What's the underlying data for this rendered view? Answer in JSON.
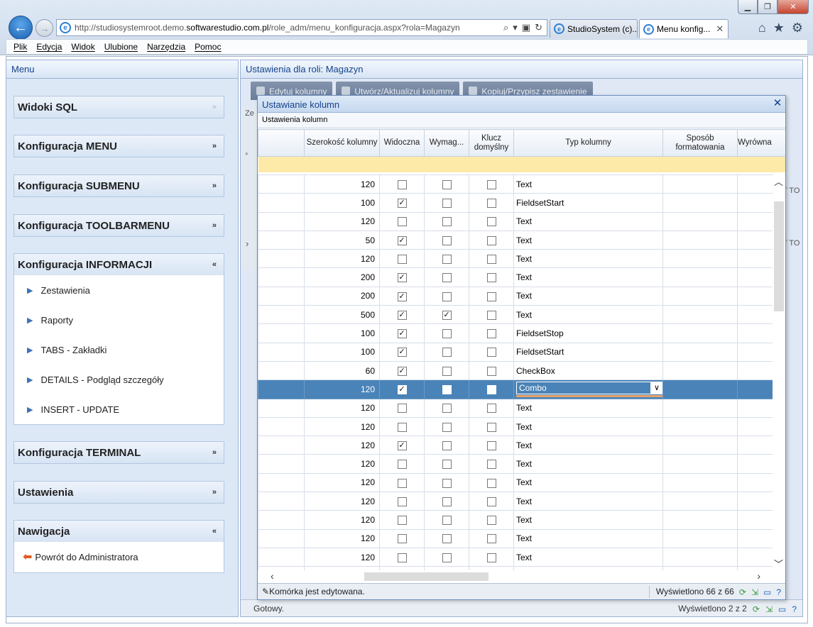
{
  "browser": {
    "url_prefix": "http://studiosystemroot.demo.",
    "url_domain": "softwarestudio.com.pl",
    "url_suffix": "/role_adm/menu_konfiguracja.aspx?rola=Magazyn",
    "tabs": [
      {
        "label": "StudioSystem (c)..."
      },
      {
        "label": "Menu konfig..."
      }
    ],
    "menu": [
      "Plik",
      "Edycja",
      "Widok",
      "Ulubione",
      "Narzędzia",
      "Pomoc"
    ]
  },
  "left_panel": {
    "title": "Menu",
    "sections": [
      {
        "title": "Widoki SQL"
      },
      {
        "title": "Konfiguracja MENU"
      },
      {
        "title": "Konfiguracja SUBMENU"
      },
      {
        "title": "Konfiguracja TOOLBARMENU"
      },
      {
        "title": "Konfiguracja INFORMACJI",
        "items": [
          "Zestawienia",
          "Raporty",
          "TABS - Zakładki",
          "DETAILS - Podgląd szczegóły",
          "INSERT - UPDATE"
        ]
      },
      {
        "title": "Konfiguracja TERMINAL"
      },
      {
        "title": "Ustawienia"
      },
      {
        "title": "Nawigacja",
        "items": [
          "Powrót do Administratora"
        ]
      }
    ]
  },
  "right_panel": {
    "title": "Ustawienia dla roli: Magazyn",
    "toolbar": [
      "Edytuj kolumny",
      "Utwórz/Aktualizuj kolumny",
      "Kopiuj/Przypisz zestawienie"
    ],
    "stub_left_label": "Ze",
    "stub_right_label": "T TO",
    "status_left": "Gotowy.",
    "status_right": "Wyświetlono 2 z 2"
  },
  "modal": {
    "title": "Ustawianie kolumn",
    "subtitle": "Ustawienia kolumn",
    "columns": [
      "",
      "Szerokość kolumny",
      "Widoczna",
      "Wymag...",
      "Klucz domyślny",
      "Typ kolumny",
      "Sposób formatowania",
      "Wyrówna"
    ],
    "rows": [
      {
        "width": "120",
        "visible": false,
        "required": false,
        "key": false,
        "type": "Text"
      },
      {
        "width": "100",
        "visible": true,
        "required": false,
        "key": false,
        "type": "FieldsetStart"
      },
      {
        "width": "120",
        "visible": false,
        "required": false,
        "key": false,
        "type": "Text"
      },
      {
        "width": "50",
        "visible": true,
        "required": false,
        "key": false,
        "type": "Text"
      },
      {
        "width": "120",
        "visible": false,
        "required": false,
        "key": false,
        "type": "Text"
      },
      {
        "width": "200",
        "visible": true,
        "required": false,
        "key": false,
        "type": "Text"
      },
      {
        "width": "200",
        "visible": true,
        "required": false,
        "key": false,
        "type": "Text"
      },
      {
        "width": "500",
        "visible": true,
        "required": true,
        "key": false,
        "type": "Text"
      },
      {
        "width": "100",
        "visible": true,
        "required": false,
        "key": false,
        "type": "FieldsetStop"
      },
      {
        "width": "100",
        "visible": true,
        "required": false,
        "key": false,
        "type": "FieldsetStart"
      },
      {
        "width": "60",
        "visible": true,
        "required": false,
        "key": false,
        "type": "CheckBox"
      },
      {
        "width": "120",
        "visible": true,
        "required": false,
        "key": false,
        "type": "Combo",
        "selected": true
      },
      {
        "width": "120",
        "visible": false,
        "required": false,
        "key": false,
        "type": "Text"
      },
      {
        "width": "120",
        "visible": false,
        "required": false,
        "key": false,
        "type": "Text"
      },
      {
        "width": "120",
        "visible": true,
        "required": false,
        "key": false,
        "type": "Text"
      },
      {
        "width": "120",
        "visible": false,
        "required": false,
        "key": false,
        "type": "Text"
      },
      {
        "width": "120",
        "visible": false,
        "required": false,
        "key": false,
        "type": "Text"
      },
      {
        "width": "120",
        "visible": false,
        "required": false,
        "key": false,
        "type": "Text"
      },
      {
        "width": "120",
        "visible": false,
        "required": false,
        "key": false,
        "type": "Text"
      },
      {
        "width": "120",
        "visible": false,
        "required": false,
        "key": false,
        "type": "Text"
      },
      {
        "width": "120",
        "visible": false,
        "required": false,
        "key": false,
        "type": "Text"
      },
      {
        "width": "",
        "visible": false,
        "required": false,
        "key": false,
        "type": ""
      }
    ],
    "status_left": "Komórka jest edytowana.",
    "status_right": "Wyświetlono 66 z 66"
  },
  "icons": {
    "back": "back-arrow-icon",
    "forward": "forward-arrow-icon",
    "home": "home-icon",
    "favorites": "star-icon",
    "tools": "gear-icon"
  },
  "colors": {
    "selected_row": "#4a83b8",
    "filter_row": "#fde9a8",
    "panel_title": "#15428b"
  }
}
